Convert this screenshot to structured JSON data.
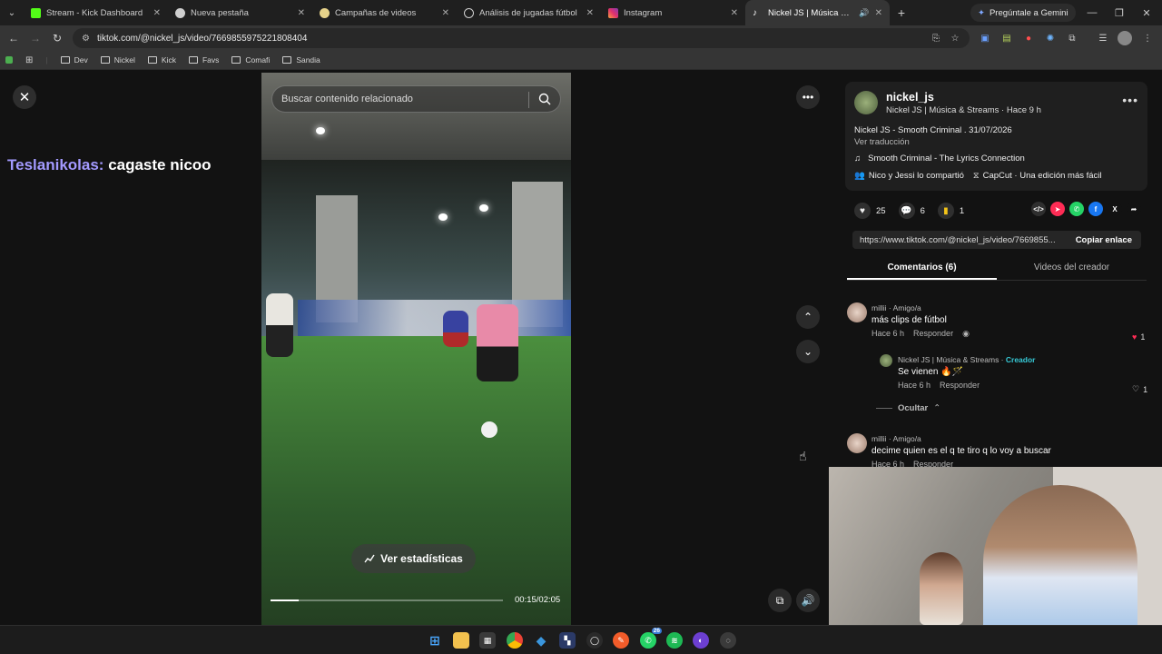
{
  "browser": {
    "tabs": [
      {
        "title": "Stream - Kick Dashboard",
        "icon": "kick-icon",
        "color": "#53fc18"
      },
      {
        "title": "Nueva pestaña",
        "icon": "chrome-icon",
        "color": "#cfcfcf"
      },
      {
        "title": "Campañas de videos",
        "icon": "campaign-icon",
        "color": "#e6d28a"
      },
      {
        "title": "Análisis de jugadas fútbol",
        "icon": "analysis-icon",
        "color": "#d0d0d0"
      },
      {
        "title": "Instagram",
        "icon": "instagram-icon",
        "color": "#e1306c"
      },
      {
        "title": "Nickel JS | Música & Streams",
        "icon": "tiktok-icon",
        "color": "#ffffff",
        "active": true
      }
    ],
    "gemini_label": "Pregúntale a Gemini",
    "url": "tiktok.com/@nickel_js/video/7669855975221808404",
    "bookmarks": [
      "Dev",
      "Nickel",
      "Kick",
      "Favs",
      "Comafi",
      "Sandia"
    ]
  },
  "chat_overlay": {
    "user": "Teslanikolas:",
    "message": "cagaste nicoo"
  },
  "video": {
    "search_placeholder": "Buscar contenido relacionado",
    "stats_label": "Ver estadísticas",
    "time": "00:15/02:05",
    "progress": 0.12
  },
  "post": {
    "username": "nickel_js",
    "subtitle": "Nickel JS | Música & Streams · Hace 9 h",
    "description": "Nickel JS - Smooth Criminal . 31/07/2026",
    "translate": "Ver traducción",
    "music": "Smooth Criminal - The Lyrics Connection",
    "shared_by": "Nico y Jessi lo compartió",
    "capcut": "CapCut · Una edición más fácil",
    "likes": "25",
    "comments_count": "6",
    "saves": "1",
    "link": "https://www.tiktok.com/@nickel_js/video/7669855...",
    "copy_label": "Copiar enlace"
  },
  "tabs": {
    "comments": "Comentarios (6)",
    "creator_videos": "Videos del creador"
  },
  "comments": [
    {
      "author": "millii · Amigo/a",
      "text": "más clips de fútbol",
      "time": "Hace 6 h",
      "reply": "Responder",
      "likes": "1"
    },
    {
      "author": "Nickel JS | Música & Streams · ",
      "creator": "Creador",
      "text": "Se vienen 🔥🪄",
      "time": "Hace 6 h",
      "reply": "Responder",
      "likes": "1"
    },
    {
      "author": "millii · Amigo/a",
      "text": "decime quien es el q te tiro q lo voy a buscar",
      "time": "Hace 6 h",
      "reply": "Responder"
    }
  ],
  "hide_label": "Ocultar",
  "taskbar_badge": "26"
}
